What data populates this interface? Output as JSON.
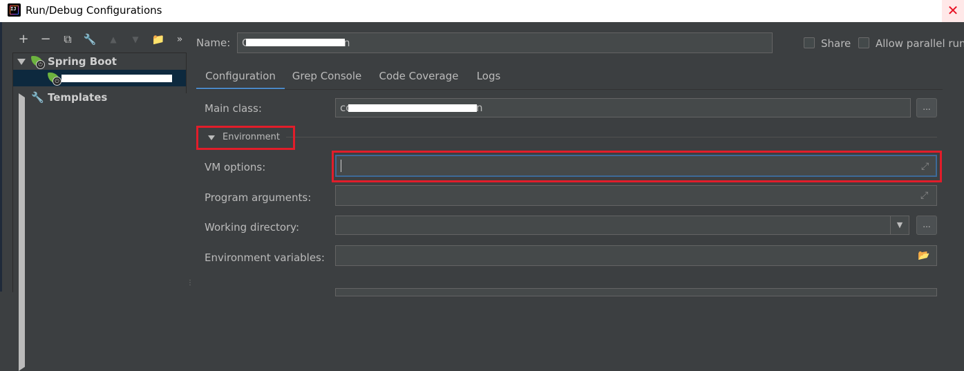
{
  "window": {
    "title": "Run/Debug Configurations",
    "close_glyph": "✕",
    "app_icon": "intellij-idea-icon",
    "app_glyph": "IJ"
  },
  "toolbar": {
    "add": "+",
    "remove": "−",
    "copy": "⧉",
    "edit": "🔧",
    "up": "▲",
    "down": "▼",
    "folder": "📁",
    "more": "»"
  },
  "tree": {
    "spring_boot": "Spring Boot",
    "templates": "Templates",
    "spring_badge": "⏻",
    "grip": "⋮"
  },
  "header": {
    "name_label": "Name:",
    "name_prefix": "C",
    "name_suffix": "n",
    "share": "Share",
    "allow_parallel": "Allow parallel run"
  },
  "tabs": [
    "Configuration",
    "Grep Console",
    "Code Coverage",
    "Logs"
  ],
  "form": {
    "main_class_label": "Main class:",
    "main_class_prefix": "co",
    "main_class_suffix": "n",
    "browse": "...",
    "environment": "Environment",
    "vm_options_label": "VM options:",
    "program_args_label": "Program arguments:",
    "working_dir_label": "Working directory:",
    "env_vars_label": "Environment variables:",
    "expand_glyph": "⤢",
    "dropdown_glyph": "▼",
    "folder_glyph": "📂"
  },
  "colors": {
    "accent": "#4a88c7",
    "highlight": "#e21d2a",
    "spring_green": "#6db33f",
    "background": "#3c3f41"
  }
}
